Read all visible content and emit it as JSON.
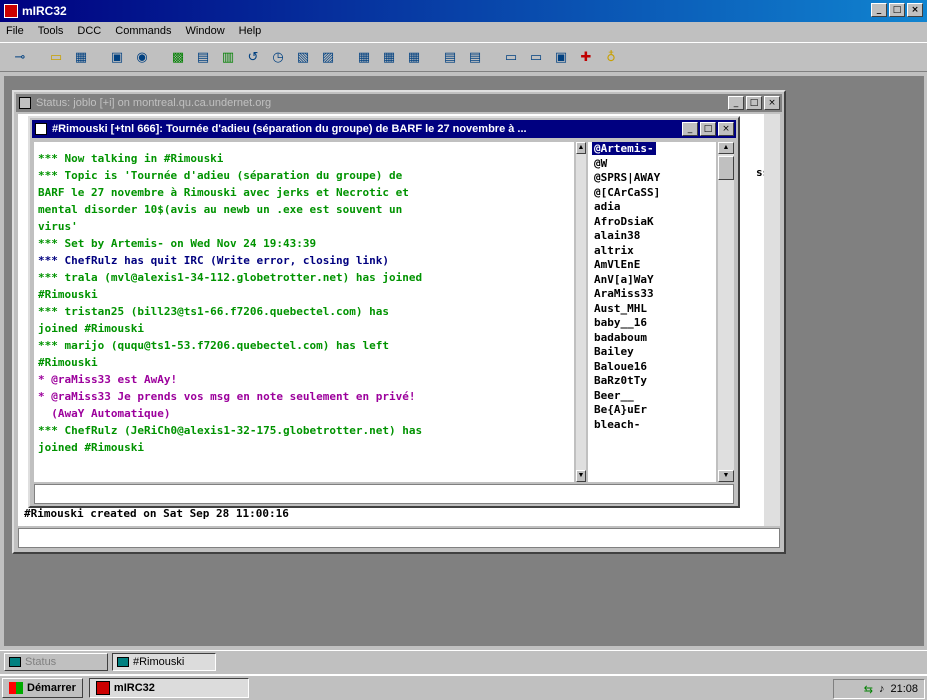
{
  "app": {
    "title": "mIRC32"
  },
  "menu": [
    "File",
    "Tools",
    "DCC",
    "Commands",
    "Window",
    "Help"
  ],
  "toolbar_icons": [
    "connect-icon",
    "folder-icon",
    "options-icon",
    "address-book-icon",
    "channels-icon",
    "finger-icon",
    "send-icon",
    "chat-icon",
    "dcc-icon",
    "notify-icon",
    "log-icon",
    "cascade-icon",
    "tile-icon",
    "arrange-icon",
    "tile-h-icon",
    "tile-v-icon",
    "list-icon",
    "minimize-all-icon",
    "help-icon",
    "about-icon"
  ],
  "status_window": {
    "title": "Status: joblo [+i] on montreal.qu.ca.undernet.org",
    "last_line": "#Rimouski created on Sat Sep 28 11:00:16",
    "side_text": "ss"
  },
  "channel_window": {
    "title": "#Rimouski [+tnl 666]: Tournée d'adieu (séparation du groupe) de BARF le 27 novembre à ...",
    "lines": [
      {
        "text": "*** Now talking in #Rimouski",
        "color": "green"
      },
      {
        "text": "*** Topic is 'Tournée d'adieu (séparation du groupe) de",
        "color": "green"
      },
      {
        "text": "BARF le 27 novembre à Rimouski avec jerks et Necrotic et",
        "color": "green"
      },
      {
        "text": "mental disorder 10$(avis au newb un .exe est souvent un",
        "color": "green"
      },
      {
        "text": "virus'",
        "color": "green"
      },
      {
        "text": "*** Set by Artemis- on Wed Nov 24 19:43:39",
        "color": "green"
      },
      {
        "text": "*** ChefRulz has quit IRC (Write error, closing link)",
        "color": "navy"
      },
      {
        "text": "*** trala (mvl@alexis1-34-112.globetrotter.net) has joined",
        "color": "green"
      },
      {
        "text": "#Rimouski",
        "color": "green"
      },
      {
        "text": "*** tristan25 (bill23@ts1-66.f7206.quebectel.com) has",
        "color": "green"
      },
      {
        "text": "joined #Rimouski",
        "color": "green"
      },
      {
        "text": "*** marijo (ququ@ts1-53.f7206.quebectel.com) has left",
        "color": "green"
      },
      {
        "text": "#Rimouski",
        "color": "green"
      },
      {
        "text": "* @raMiss33 est AwAy!",
        "color": "purple"
      },
      {
        "text": "* @raMiss33 Je prends vos msg en note seulement en privé!",
        "color": "purple"
      },
      {
        "text": "  (AwaY Automatique)",
        "color": "purple"
      },
      {
        "text": "*** ChefRulz (JeRiCh0@alexis1-32-175.globetrotter.net) has",
        "color": "green"
      },
      {
        "text": "joined #Rimouski",
        "color": "green"
      }
    ],
    "nicks": [
      "@Artemis-",
      "@W",
      "@SPRS|AWAY",
      "@[CArCaSS]",
      "adia",
      "AfroDsiaK",
      "alain38",
      "altrix",
      "AmVlEnE",
      "AnV[a]WaY",
      "AraMiss33",
      "Aust_MHL",
      "baby__16",
      "badaboum",
      "Bailey",
      "Baloue16",
      "BaRz0tTy",
      "Beer__",
      "Be{A}uEr",
      "bleach-"
    ]
  },
  "switchbar": [
    {
      "label": "Status",
      "active": false
    },
    {
      "label": "#Rimouski",
      "active": true
    }
  ],
  "taskbar": {
    "start": "Démarrer",
    "task": "mIRC32",
    "clock": "21:08"
  }
}
